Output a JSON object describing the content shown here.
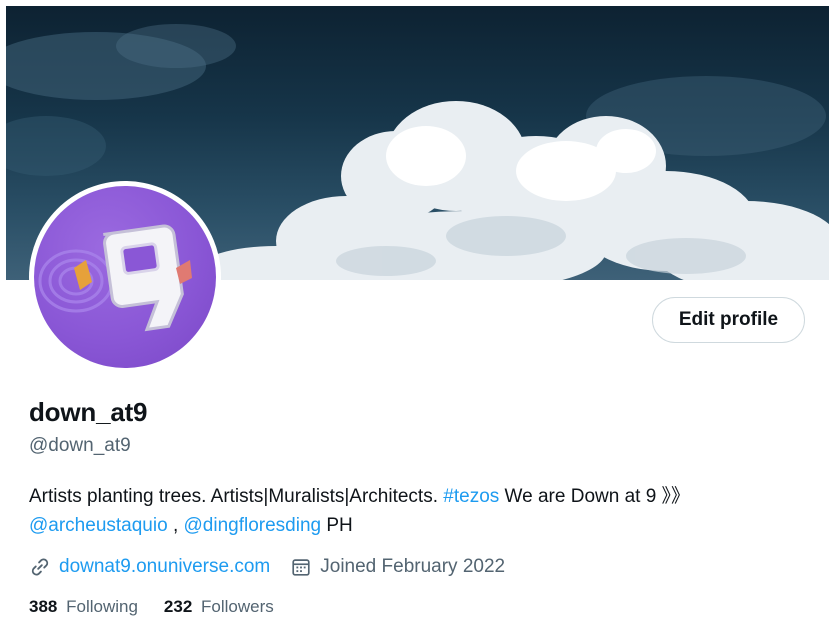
{
  "profile": {
    "display_name": "down_at9",
    "handle": "@down_at9",
    "edit_label": "Edit profile",
    "bio": {
      "text1": "Artists planting trees. Artists|Muralists|Architects.",
      "hashtag": "#tezos",
      "text2": "We are Down at 9 》》",
      "mention1": "@archeustaquio",
      "separator": ",",
      "mention2": "@dingfloresding",
      "text3": "PH"
    },
    "website": "downat9.onuniverse.com",
    "joined": "Joined February 2022",
    "following_count": "388",
    "following_label": "Following",
    "followers_count": "232",
    "followers_label": "Followers"
  },
  "colors": {
    "accent": "#1d9bf0",
    "secondary_text": "#536471",
    "primary_text": "#0f1419",
    "avatar_bg": "#8a57d6"
  },
  "icons": {
    "website": "link-icon",
    "joined": "calendar-icon"
  }
}
